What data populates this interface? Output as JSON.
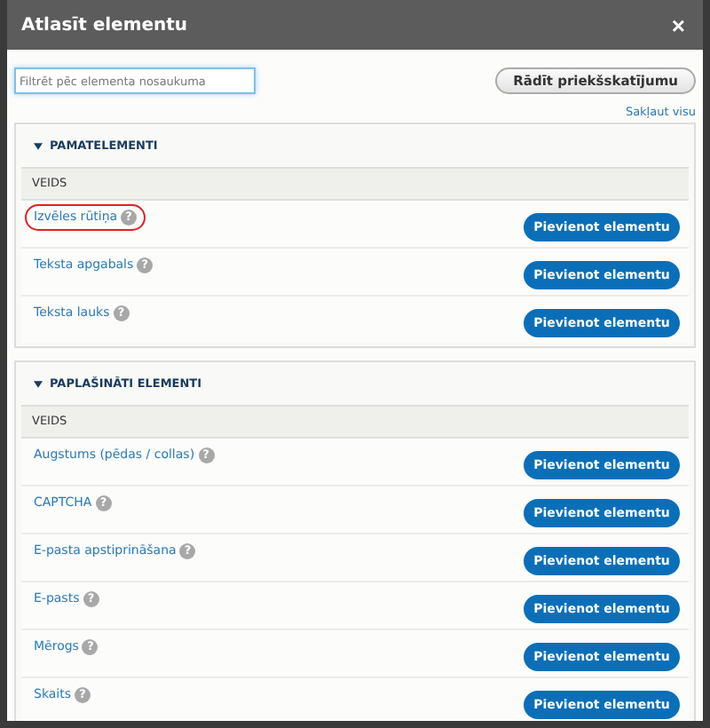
{
  "window": {
    "title": "Atlasīt elementu",
    "close": "×"
  },
  "filter": {
    "placeholder": "Filtrēt pēc elementa nosaukuma"
  },
  "preview_button": "Rādīt priekšskatījumu",
  "collapse_link": "Sakļaut visu",
  "sections": [
    {
      "title": "PAMATELEMENTI",
      "expanded": true,
      "column": "VEIDS",
      "items": [
        {
          "label": "Izvēles rūtiņa",
          "help": "?",
          "button": "Pievienot elementu",
          "highlighted": true
        },
        {
          "label": "Teksta apgabals",
          "help": "?",
          "button": "Pievienot elementu",
          "highlighted": false
        },
        {
          "label": "Teksta lauks",
          "help": "?",
          "button": "Pievienot elementu",
          "highlighted": false
        }
      ]
    },
    {
      "title": "PAPLAŠINĀTI ELEMENTI",
      "expanded": true,
      "column": "VEIDS",
      "items": [
        {
          "label": "Augstums (pēdas / collas)",
          "help": "?",
          "button": "Pievienot elementu",
          "highlighted": false
        },
        {
          "label": "CAPTCHA",
          "help": "?",
          "button": "Pievienot elementu",
          "highlighted": false
        },
        {
          "label": "E-pasta apstiprināšana",
          "help": "?",
          "button": "Pievienot elementu",
          "highlighted": false
        },
        {
          "label": "E-pasts",
          "help": "?",
          "button": "Pievienot elementu",
          "highlighted": false
        },
        {
          "label": "Mērogs",
          "help": "?",
          "button": "Pievienot elementu",
          "highlighted": false
        },
        {
          "label": "Skaits",
          "help": "?",
          "button": "Pievienot elementu",
          "highlighted": false
        }
      ]
    }
  ]
}
